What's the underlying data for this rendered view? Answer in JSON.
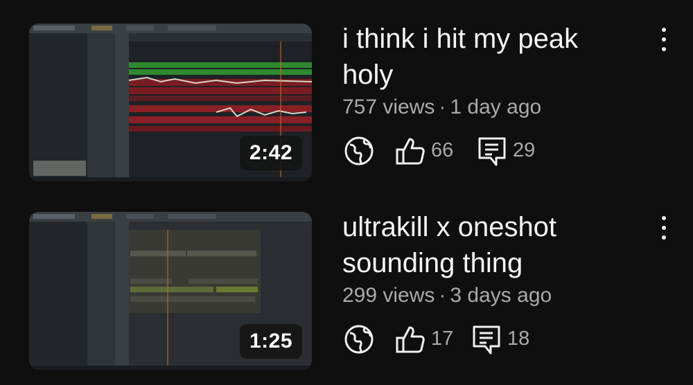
{
  "videos": [
    {
      "title_line1": "i think i hit my peak",
      "title_line2": "holy",
      "views": "757 views",
      "separator": "·",
      "age": "1 day ago",
      "duration": "2:42",
      "likes": "66",
      "comments": "29",
      "visibility_icon": "globe-icon",
      "like_icon": "thumbs-up-icon",
      "comment_icon": "comment-icon",
      "menu_icon": "more-vert-icon"
    },
    {
      "title_line1": "ultrakill x oneshot",
      "title_line2": "sounding thing",
      "views": "299 views",
      "separator": "·",
      "age": "3 days ago",
      "duration": "1:25",
      "likes": "17",
      "comments": "18",
      "visibility_icon": "globe-icon",
      "like_icon": "thumbs-up-icon",
      "comment_icon": "comment-icon",
      "menu_icon": "more-vert-icon"
    }
  ],
  "colors": {
    "background": "#0f0f0f",
    "title": "#f5f5f5",
    "secondary_text": "#aaaaaa",
    "icon": "#f1f1f1"
  }
}
